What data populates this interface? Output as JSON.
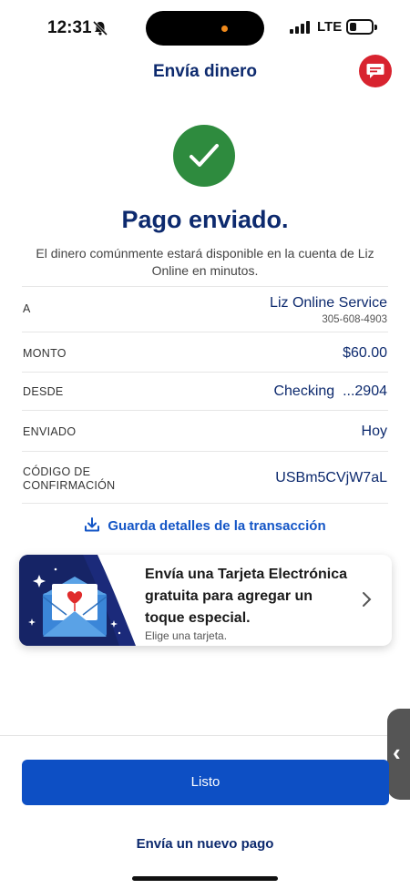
{
  "status_bar": {
    "time": "12:31",
    "network": "LTE"
  },
  "header": {
    "title": "Envía dinero"
  },
  "confirmation": {
    "headline": "Pago enviado.",
    "message": "El dinero comúnmente estará disponible en la cuenta de Liz Online en minutos."
  },
  "details": {
    "to": {
      "label": "A",
      "value": "Liz Online Service",
      "phone": "305-608-4903"
    },
    "amount": {
      "label": "MONTO",
      "value": "$60.00"
    },
    "from": {
      "label": "DESDE",
      "value": "Checking  ...2904"
    },
    "sent": {
      "label": "ENVIADO",
      "value": "Hoy"
    },
    "confirmation_code": {
      "label_line1": "CÓDIGO DE",
      "label_line2": "CONFIRMACIÓN",
      "value": "USBm5CVjW7aL"
    }
  },
  "save_link": {
    "label": "Guarda detalles de la transacción"
  },
  "ecard_promo": {
    "title": "Envía una Tarjeta Electrónica gratuita para agregar un toque especial.",
    "subtitle": "Elige una tarjeta."
  },
  "actions": {
    "done": "Listo",
    "new_payment": "Envía un nuevo pago"
  },
  "colors": {
    "brand_navy": "#0d2a6e",
    "primary_blue": "#0d4fc4",
    "success_green": "#2e8b3e",
    "chat_red": "#d8232f"
  },
  "icons": [
    "bell-slash-icon",
    "signal-icon",
    "battery-icon",
    "chat-icon",
    "checkmark-icon",
    "download-icon",
    "envelope-heart-icon",
    "chevron-right-icon",
    "chevron-left-icon"
  ]
}
